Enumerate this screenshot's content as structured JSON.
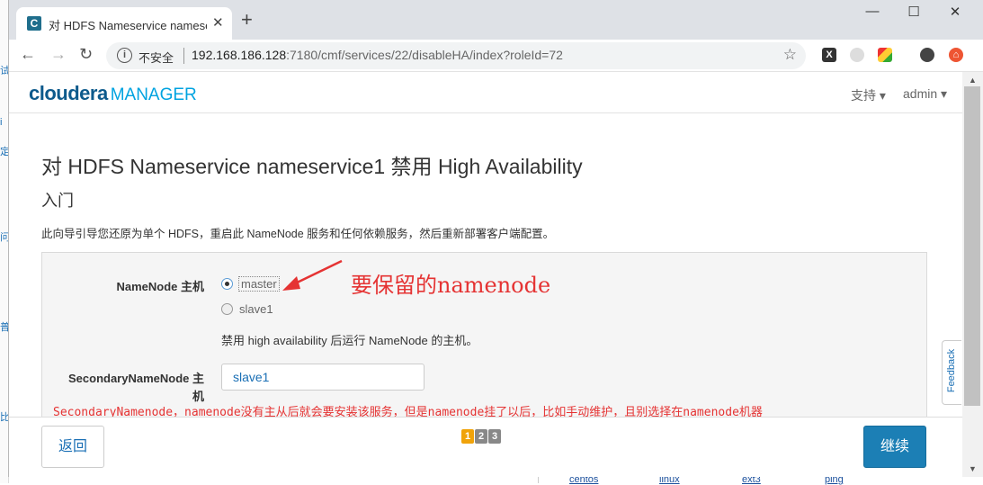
{
  "browser": {
    "tab_title": "对 HDFS Nameservice namese",
    "security_label": "不安全",
    "url_host": "192.168.186.128",
    "url_rest": ":7180/cmf/services/22/disableHA/index?roleId=72"
  },
  "header": {
    "logo_brand": "cloudera",
    "logo_product": "MANAGER",
    "support_menu": "支持 ▾",
    "user_menu": "admin ▾"
  },
  "wizard": {
    "title": "对 HDFS Nameservice nameservice1 禁用 High Availability",
    "step_title": "入门",
    "description": "此向导引导您还原为单个 HDFS，重启此 NameNode 服务和任何依赖服务，然后重新部署客户端配置。",
    "namenode_label": "NameNode 主机",
    "namenode_options": [
      "master",
      "slave1"
    ],
    "namenode_selected": "master",
    "namenode_help": "禁用 high availability 后运行 NameNode 的主机。",
    "secondary_label_line1": "SecondaryNameNode 主",
    "secondary_label_line2": "机",
    "secondary_value": "slave1"
  },
  "annotations": {
    "keep_namenode": "要保留的namenode",
    "secondary_note": "SecondaryNamenode，namenode没有主从后就会要安装该服务，但是namenode挂了以后，比如手动维护，且别选择在namenode机器"
  },
  "footer": {
    "back_label": "返回",
    "pages": [
      "1",
      "2",
      "3"
    ],
    "current_page": "1",
    "next_label": "继续"
  },
  "feedback_label": "Feedback",
  "background_links": [
    "centos",
    "linux",
    "ext3",
    "ping"
  ],
  "colors": {
    "brand": "#0d5a8c",
    "accent": "#1c7fb5",
    "annotation": "#e53333",
    "pager_active": "#f0a30a"
  }
}
